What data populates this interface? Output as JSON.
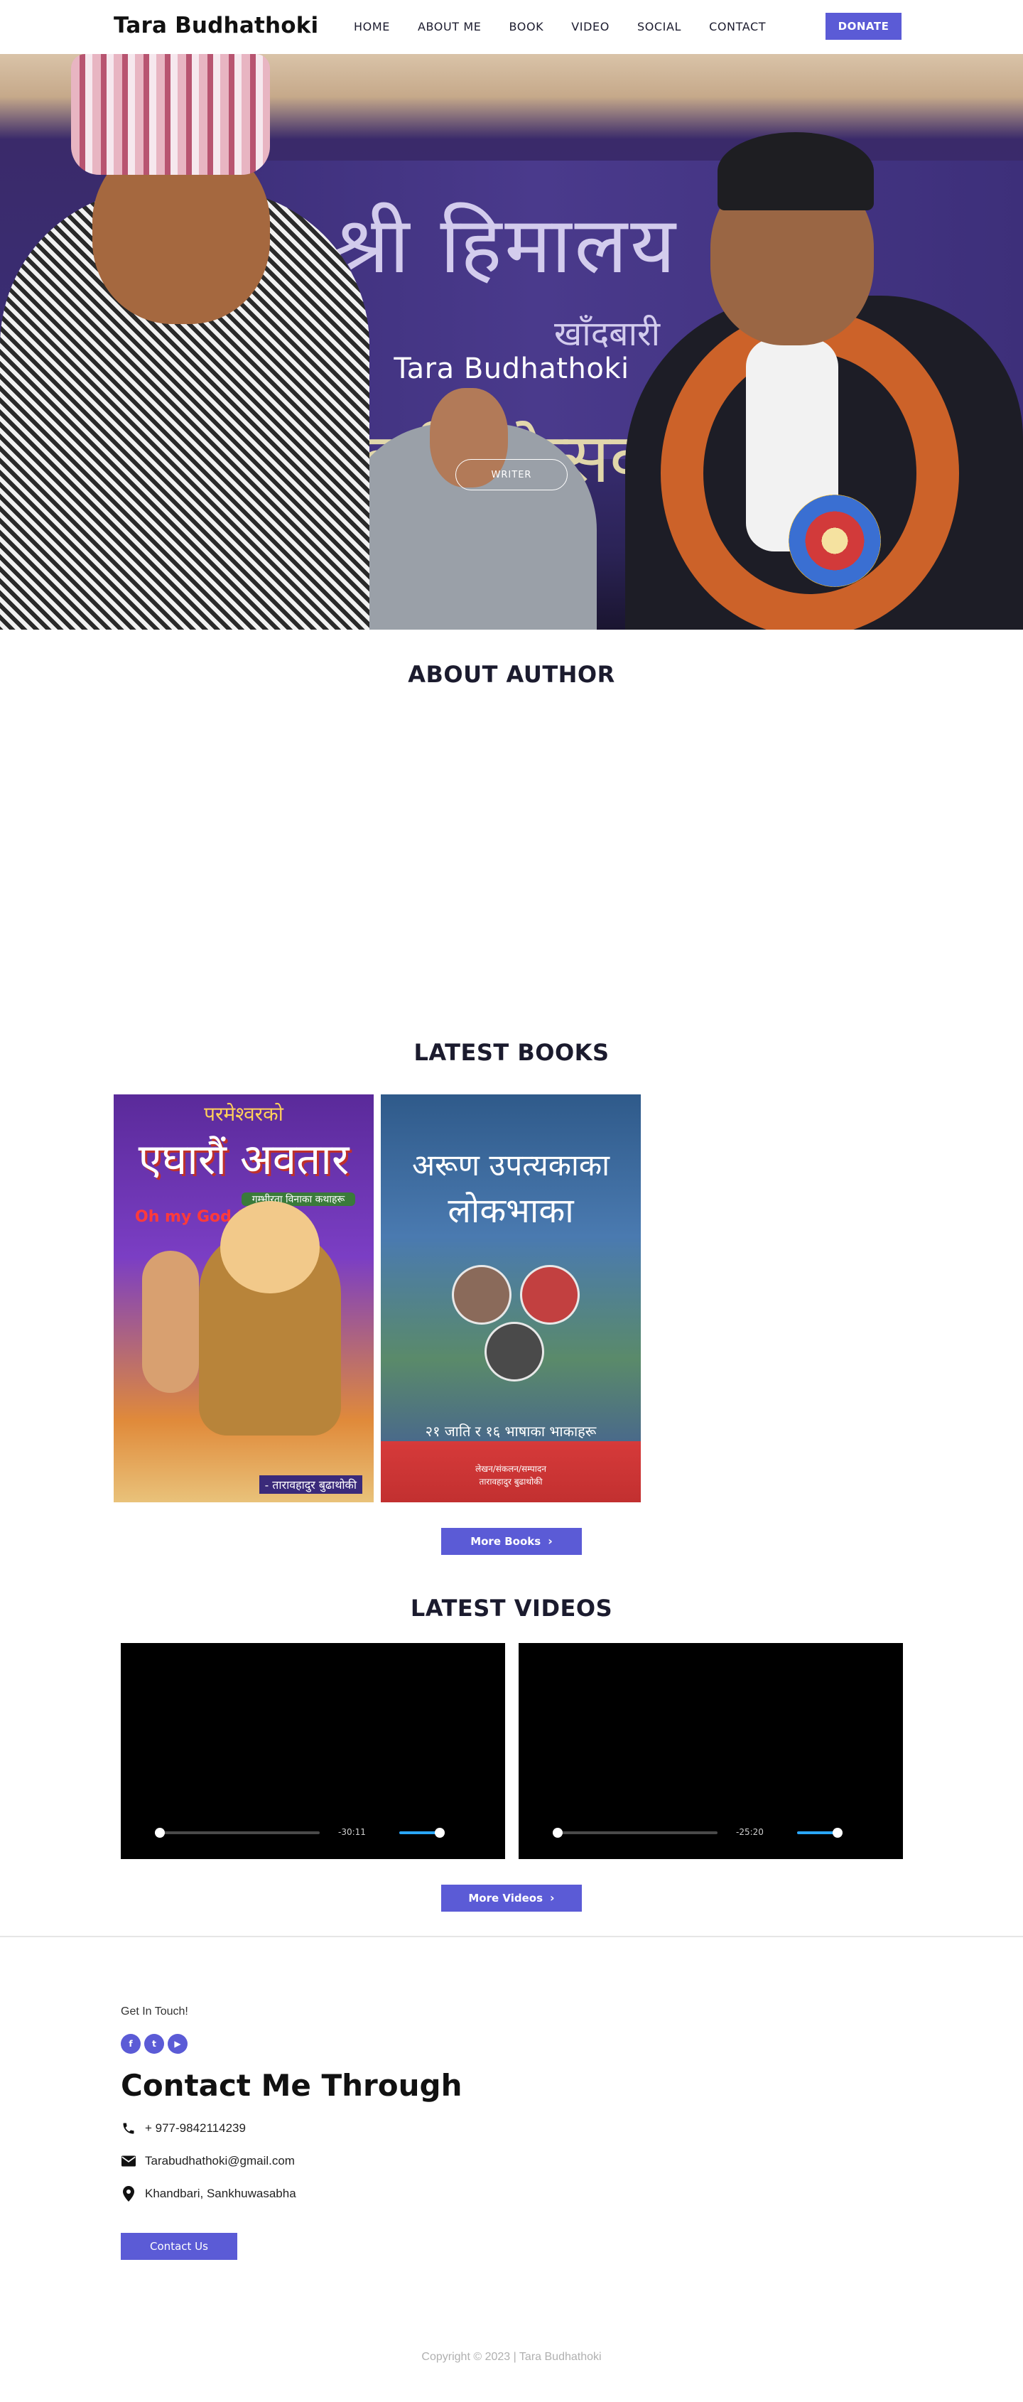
{
  "header": {
    "brand": "Tara Budhathoki",
    "nav": [
      "HOME",
      "ABOUT ME",
      "BOOK",
      "VIDEO",
      "SOCIAL",
      "CONTACT"
    ],
    "donate_label": "DONATE"
  },
  "hero": {
    "title": "Tara Budhathoki",
    "button_label": "WRITER",
    "banner_line1": "श्री हिमालय",
    "banner_line2": "खाँदबारी",
    "banner_line3": "औं वार्षिकोत्सव"
  },
  "about": {
    "title": "ABOUT AUTHOR"
  },
  "books": {
    "title": "LATEST BOOKS",
    "book1": {
      "top": "परमेश्वरको",
      "title": "एघारौं अवतार",
      "tag": "गम्भीरता विनाका कथाहरू",
      "oh": "Oh my God !!",
      "author": "- तारावहादुर बुढाथोकी"
    },
    "book2": {
      "title1": "अरूण उपत्यकाका",
      "title2": "लोकभाका",
      "caption": "२१ जाति र १६ भाषाका भाकाहरू",
      "foot1": "लेखन/संकलन/सम्पादन",
      "foot2": "तारावहादुर बुढाथोकी"
    },
    "more_label": "More Books"
  },
  "videos": {
    "title": "LATEST VIDEOS",
    "items": [
      {
        "time": "-30:11"
      },
      {
        "time": "-25:20"
      }
    ],
    "more_label": "More Videos"
  },
  "contact": {
    "kicker": "Get In Touch!",
    "social": [
      "f",
      "t",
      "▶"
    ],
    "title": "Contact Me Through",
    "phone": "+ 977-9842114239",
    "email": "Tarabudhathoki@gmail.com",
    "address": "Khandbari, Sankhuwasabha",
    "button_label": "Contact Us"
  },
  "footer": {
    "copyright": "Copyright © 2023 | Tara Budhathoki"
  },
  "colors": {
    "accent": "#5b5bd6",
    "text": "#1b1b2e",
    "volume": "#2aa7ff"
  }
}
